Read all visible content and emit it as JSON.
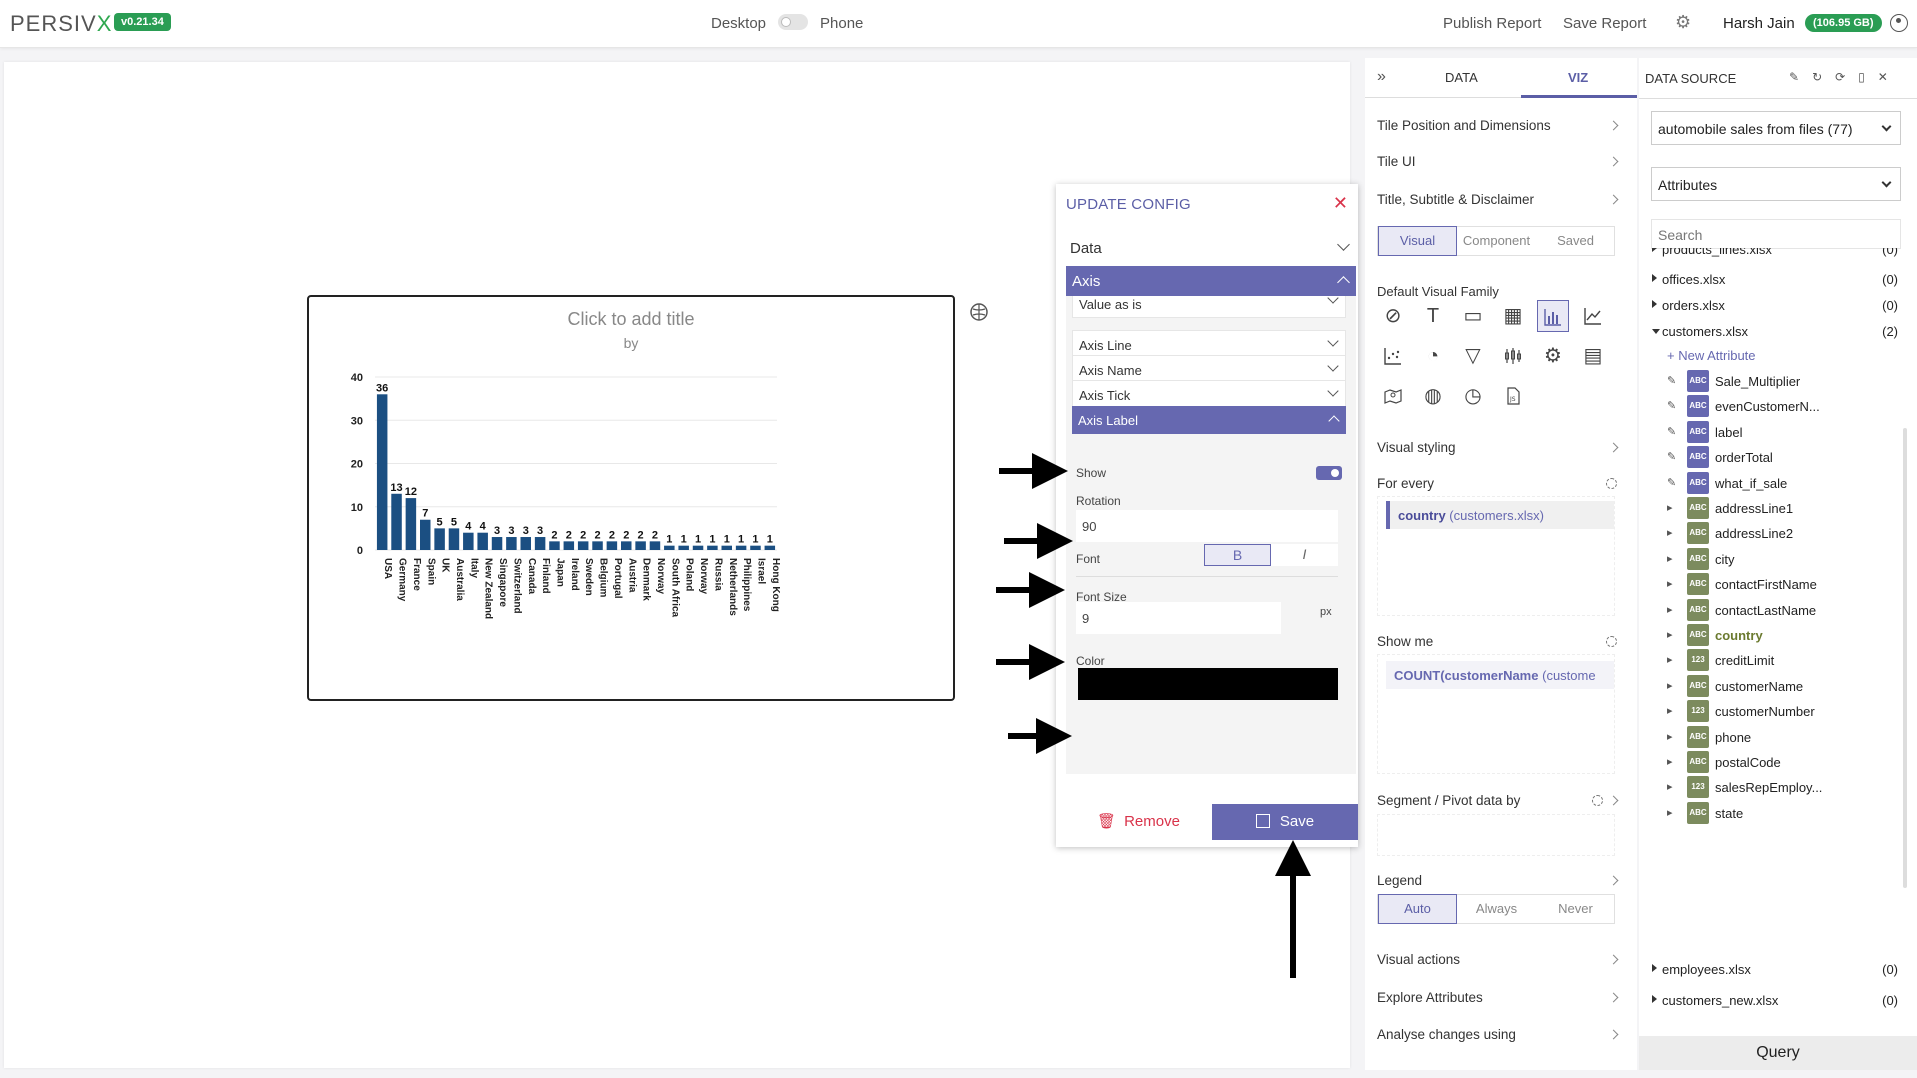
{
  "header": {
    "logo_main": "PERSIV",
    "logo_x": "X",
    "version": "v0.21.34",
    "desktop_label": "Desktop",
    "phone_label": "Phone",
    "publish_label": "Publish Report",
    "save_label": "Save Report",
    "user_name": "Harsh Jain",
    "storage": "(106.95 GB)"
  },
  "tile": {
    "title": "Click to add title",
    "subtitle": "by"
  },
  "chart_data": {
    "type": "bar",
    "categories": [
      "USA",
      "Germany",
      "France",
      "Spain",
      "UK",
      "Australia",
      "Italy",
      "New Zealand",
      "Singapore",
      "Switzerland",
      "Canada",
      "Finland",
      "Japan",
      "Ireland",
      "Sweden",
      "Belgium",
      "Portugal",
      "Austria",
      "Denmark",
      "Norway",
      "South Africa",
      "Poland",
      "Norway",
      "Russia",
      "Netherlands",
      "Philippines",
      "Israel",
      "Hong Kong"
    ],
    "values": [
      36,
      13,
      12,
      7,
      5,
      5,
      4,
      4,
      3,
      3,
      3,
      3,
      2,
      2,
      2,
      2,
      2,
      2,
      2,
      2,
      1,
      1,
      1,
      1,
      1,
      1,
      1,
      1
    ],
    "yticks": [
      0,
      10,
      20,
      30,
      40
    ],
    "ylim": [
      0,
      40
    ],
    "bar_color": "#1b4f82",
    "xlabel_rotation": 90
  },
  "config": {
    "title": "UPDATE CONFIG",
    "data_section": "Data",
    "axis_section": "Axis",
    "value_as_is": "Value as is",
    "axis_line": "Axis Line",
    "axis_name": "Axis Name",
    "axis_tick": "Axis Tick",
    "axis_label": "Axis Label",
    "show_label": "Show",
    "rotation_label": "Rotation",
    "rotation_value": "90",
    "font_label": "Font",
    "bold_glyph": "B",
    "italic_glyph": "I",
    "font_size_label": "Font Size",
    "font_size_value": "9",
    "px_unit": "px",
    "color_label": "Color",
    "color_value": "#000000",
    "remove_label": "Remove",
    "save_label": "Save"
  },
  "viz": {
    "tab_data": "DATA",
    "tab_viz": "VIZ",
    "tile_position": "Tile Position and Dimensions",
    "tile_ui": "Tile UI",
    "title_subtitle": "Title, Subtitle & Disclaimer",
    "seg_visual": "Visual",
    "seg_component": "Component",
    "seg_saved": "Saved",
    "default_family": "Default Visual Family",
    "visual_styling": "Visual styling",
    "for_every": "For every",
    "for_every_field": "country",
    "for_every_source": "(customers.xlsx)",
    "show_me": "Show me",
    "show_me_field": "COUNT(customerName",
    "show_me_source": "(custome",
    "segment_pivot": "Segment / Pivot data by",
    "legend": "Legend",
    "legend_auto": "Auto",
    "legend_always": "Always",
    "legend_never": "Never",
    "visual_actions": "Visual actions",
    "explore_attributes": "Explore Attributes",
    "analyse_changes": "Analyse changes using"
  },
  "datasource": {
    "title": "DATA SOURCE",
    "source_select": "automobile sales from files (77)",
    "attr_select": "Attributes",
    "search_placeholder": "Search",
    "files": [
      {
        "name": "products_lines.xlsx",
        "count": "(0)"
      },
      {
        "name": "offices.xlsx",
        "count": "(0)"
      },
      {
        "name": "orders.xlsx",
        "count": "(0)"
      },
      {
        "name": "customers.xlsx",
        "count": "(2)"
      }
    ],
    "new_attribute": "+ New Attribute",
    "attributes": [
      {
        "name": "Sale_Multiplier",
        "type": "ABC"
      },
      {
        "name": "evenCustomerN...",
        "type": "ABC"
      },
      {
        "name": "label",
        "type": "ABC"
      },
      {
        "name": "orderTotal",
        "type": "ABC"
      },
      {
        "name": "what_if_sale",
        "type": "ABC"
      },
      {
        "name": "addressLine1",
        "type": "ABC"
      },
      {
        "name": "addressLine2",
        "type": "ABC"
      },
      {
        "name": "city",
        "type": "ABC"
      },
      {
        "name": "contactFirstName",
        "type": "ABC"
      },
      {
        "name": "contactLastName",
        "type": "ABC"
      },
      {
        "name": "country",
        "type": "ABC"
      },
      {
        "name": "creditLimit",
        "type": "123"
      },
      {
        "name": "customerName",
        "type": "ABC"
      },
      {
        "name": "customerNumber",
        "type": "123"
      },
      {
        "name": "phone",
        "type": "ABC"
      },
      {
        "name": "postalCode",
        "type": "ABC"
      },
      {
        "name": "salesRepEmploy...",
        "type": "123"
      },
      {
        "name": "state",
        "type": "ABC"
      }
    ],
    "files_after": [
      {
        "name": "employees.xlsx",
        "count": "(0)"
      },
      {
        "name": "customers_new.xlsx",
        "count": "(0)"
      }
    ],
    "query_label": "Query"
  }
}
